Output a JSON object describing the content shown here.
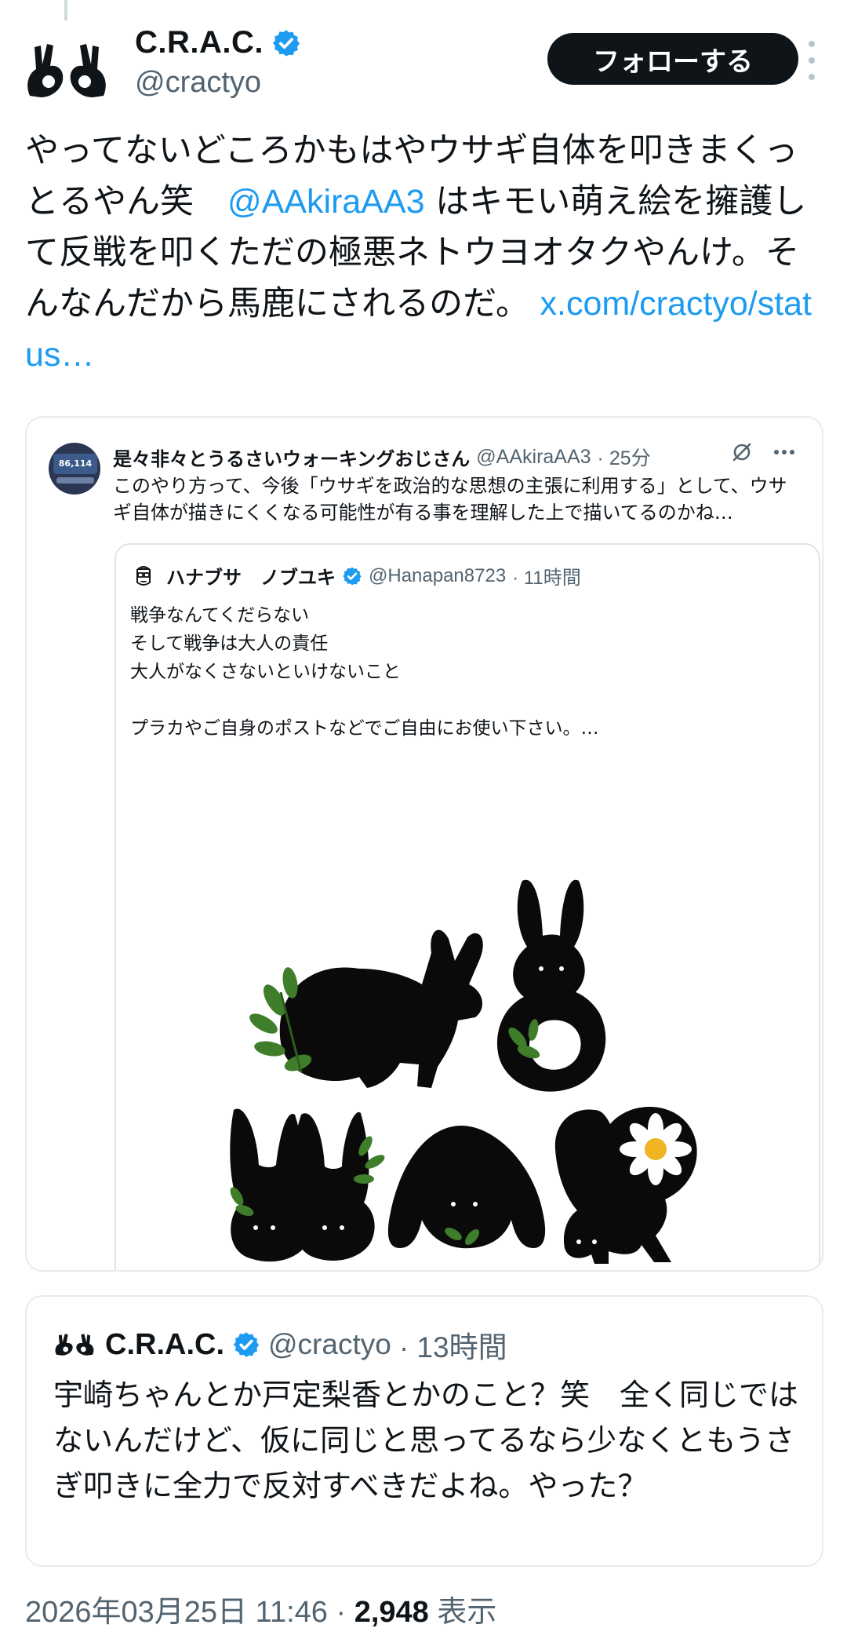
{
  "tweet": {
    "author_name": "C.R.A.C.",
    "author_handle": "@cractyo",
    "follow_label": "フォローする",
    "text_before": "やってないどころかもはやウサギ自体を叩きまくっとるやん笑　",
    "mention": "@AAkiraAA3",
    "text_after": " はキモい萌え絵を擁護して反戦を叩くただの極悪ネトウヨオタクやんけ。そんなんだから馬鹿にされるのだ。",
    "link": "x.com/cractyo/status…",
    "timestamp": "2026年03月25日 11:46",
    "separator": " · ",
    "views": "2,948",
    "views_label": " 表示"
  },
  "quote1": {
    "author_name": "是々非々とうるさいウォーキングおじさん",
    "author_handle": "@AAkiraAA3",
    "time": "· 25分",
    "avatar_step_count": "86,114",
    "text": "このやり方って、今後「ウサギを政治的な思想の主張に利用する」として、ウサギ自体が描きにくくなる可能性が有る事を理解した上で描いてるのかね…"
  },
  "quote2": {
    "author_name": "ハナブサ　ノブユキ",
    "author_handle": "@Hanapan8723",
    "time": "· 11時間",
    "lines": [
      "戦争なんてくだらない",
      "そして戦争は大人の責任",
      "大人がなくさないといけないこと",
      "",
      "プラカやご自身のポストなどでご自由にお使い下さい。…"
    ]
  },
  "quote3": {
    "author_name": "C.R.A.C.",
    "author_handle": "@cractyo",
    "time": "· 13時間",
    "text": "宇崎ちゃんとか戸定梨香とかのこと？笑　全く同じではないんだけど、仮に同じと思ってるなら少なくともうさぎ叩きに全力で反対すべきだよね。やった？"
  },
  "colors": {
    "accent": "#1d9bf0",
    "text": "#0f1419",
    "muted": "#536471",
    "border": "#e6ecf0"
  },
  "icons": [
    "ok-hands-logo-icon",
    "verified-badge-icon",
    "more-vertical-icon",
    "grok-slash-icon",
    "more-horizontal-icon",
    "glasses-face-avatar-icon"
  ]
}
